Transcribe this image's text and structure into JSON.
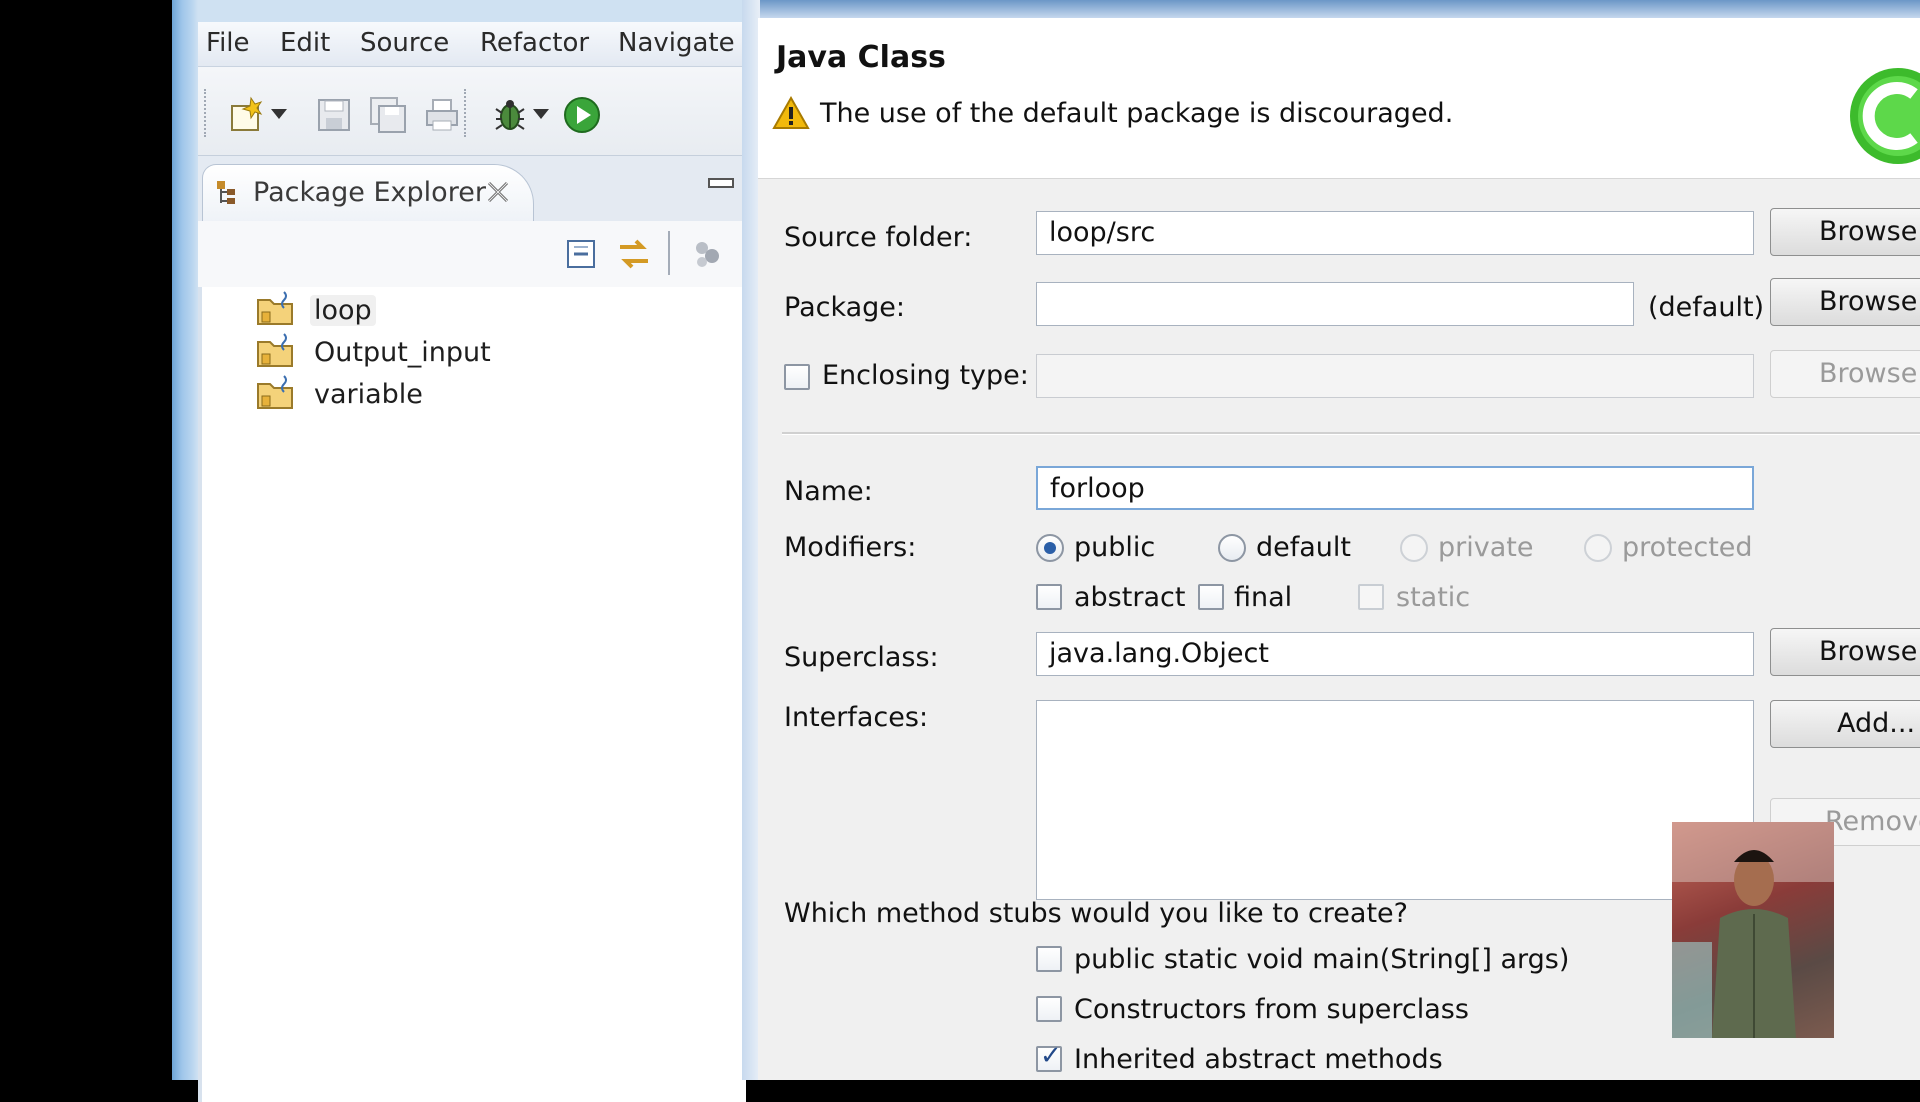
{
  "eclipse": {
    "menu": [
      "File",
      "Edit",
      "Source",
      "Refactor",
      "Navigate"
    ],
    "package_explorer": {
      "title": "Package Explorer",
      "projects": [
        {
          "name": "loop",
          "selected": true
        },
        {
          "name": "Output_input",
          "selected": false
        },
        {
          "name": "variable",
          "selected": false
        }
      ]
    }
  },
  "dialog": {
    "title": "Java Class",
    "warning": "The use of the default package is discouraged.",
    "source_folder": {
      "label": "Source folder:",
      "value": "loop/src",
      "button": "Browse..."
    },
    "package": {
      "label": "Package:",
      "value": "",
      "suffix": "(default)",
      "button": "Browse..."
    },
    "enclosing_type": {
      "label": "Enclosing type:",
      "checked": false,
      "value": "",
      "button": "Browse..."
    },
    "name": {
      "label": "Name:",
      "value": "forloop"
    },
    "modifiers": {
      "label": "Modifiers:",
      "access": [
        {
          "label": "public",
          "selected": true,
          "enabled": true
        },
        {
          "label": "default",
          "selected": false,
          "enabled": true
        },
        {
          "label": "private",
          "selected": false,
          "enabled": false
        },
        {
          "label": "protected",
          "selected": false,
          "enabled": false
        }
      ],
      "flags": [
        {
          "label": "abstract",
          "checked": false,
          "enabled": true
        },
        {
          "label": "final",
          "checked": false,
          "enabled": true
        },
        {
          "label": "static",
          "checked": false,
          "enabled": false
        }
      ]
    },
    "superclass": {
      "label": "Superclass:",
      "value": "java.lang.Object",
      "button": "Browse..."
    },
    "interfaces": {
      "label": "Interfaces:",
      "add_button": "Add...",
      "remove_button": "Remove"
    },
    "method_stubs": {
      "question": "Which method stubs would you like to create?",
      "options": [
        {
          "label": "public static void main(String[] args)",
          "checked": false
        },
        {
          "label": "Constructors from superclass",
          "checked": false
        },
        {
          "label": "Inherited abstract methods",
          "checked": true
        }
      ]
    }
  },
  "colors": {
    "accent_blue": "#2b5fa8",
    "warning_yellow": "#f2b90c",
    "class_logo_green": "#3dbb2c"
  }
}
